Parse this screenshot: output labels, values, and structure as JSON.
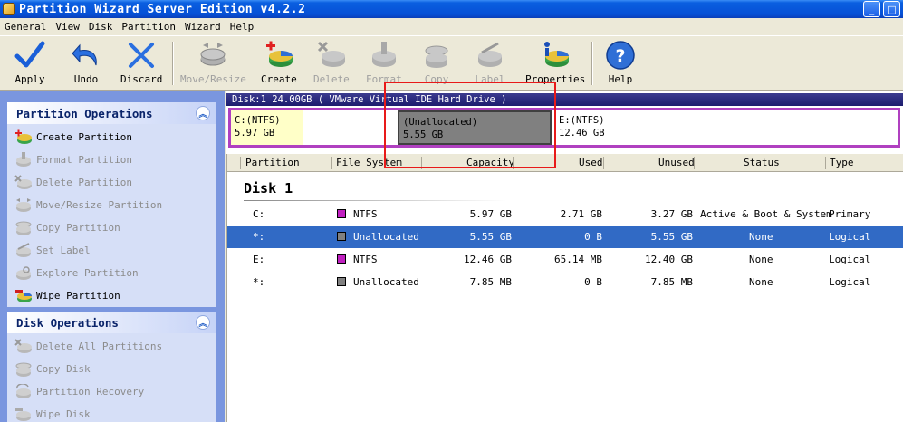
{
  "window": {
    "title": "Partition Wizard Server Edition v4.2.2",
    "min_label": "_",
    "max_label": "□"
  },
  "menu": [
    {
      "label": "General"
    },
    {
      "label": "View"
    },
    {
      "label": "Disk"
    },
    {
      "label": "Partition"
    },
    {
      "label": "Wizard"
    },
    {
      "label": "Help"
    }
  ],
  "toolbar": {
    "apply": "Apply",
    "undo": "Undo",
    "discard": "Discard",
    "move_resize": "Move/Resize",
    "create": "Create",
    "delete": "Delete",
    "format": "Format",
    "copy": "Copy",
    "label": "Label",
    "properties": "Properties",
    "help": "Help"
  },
  "partition_ops": {
    "title": "Partition Operations",
    "items": [
      {
        "label": "Create Partition",
        "enabled": true
      },
      {
        "label": "Format Partition",
        "enabled": false
      },
      {
        "label": "Delete Partition",
        "enabled": false
      },
      {
        "label": "Move/Resize Partition",
        "enabled": false
      },
      {
        "label": "Copy Partition",
        "enabled": false
      },
      {
        "label": "Set Label",
        "enabled": false
      },
      {
        "label": "Explore Partition",
        "enabled": false
      },
      {
        "label": "Wipe Partition",
        "enabled": true
      }
    ]
  },
  "disk_ops": {
    "title": "Disk Operations",
    "items": [
      {
        "label": "Delete All Partitions",
        "enabled": false
      },
      {
        "label": "Copy Disk",
        "enabled": false
      },
      {
        "label": "Partition Recovery",
        "enabled": false
      },
      {
        "label": "Wipe Disk",
        "enabled": false
      }
    ]
  },
  "diskmap": {
    "header": "Disk:1 24.00GB  ( VMware Virtual IDE Hard Drive )",
    "partitions": [
      {
        "name": "C:(NTFS)",
        "size": "5.97 GB"
      },
      {
        "name": "(Unallocated)",
        "size": "5.55 GB"
      },
      {
        "name": "E:(NTFS)",
        "size": "12.46 GB"
      }
    ]
  },
  "table": {
    "columns": [
      "Partition",
      "File System",
      "Capacity",
      "Used",
      "Unused",
      "Status",
      "Type"
    ],
    "disk_label": "Disk 1",
    "rows": [
      {
        "partition": "C:",
        "fs": "NTFS",
        "fs_color": "#c020c0",
        "capacity": "5.97 GB",
        "used": "2.71 GB",
        "unused": "3.27 GB",
        "status": "Active & Boot & System",
        "type": "Primary"
      },
      {
        "partition": "*:",
        "fs": "Unallocated",
        "fs_color": "#808080",
        "capacity": "5.55 GB",
        "used": "0 B",
        "unused": "5.55 GB",
        "status": "None",
        "type": "Logical"
      },
      {
        "partition": "E:",
        "fs": "NTFS",
        "fs_color": "#c020c0",
        "capacity": "12.46 GB",
        "used": "65.14 MB",
        "unused": "12.40 GB",
        "status": "None",
        "type": "Logical"
      },
      {
        "partition": "*:",
        "fs": "Unallocated",
        "fs_color": "#808080",
        "capacity": "7.85 MB",
        "used": "0 B",
        "unused": "7.85 MB",
        "status": "None",
        "type": "Logical"
      }
    ],
    "selected_row": 1
  },
  "colors": {
    "accent": "#316ac5",
    "ntfs": "#c020c0",
    "unallocated": "#808080",
    "highlight": "#e81a1a"
  }
}
